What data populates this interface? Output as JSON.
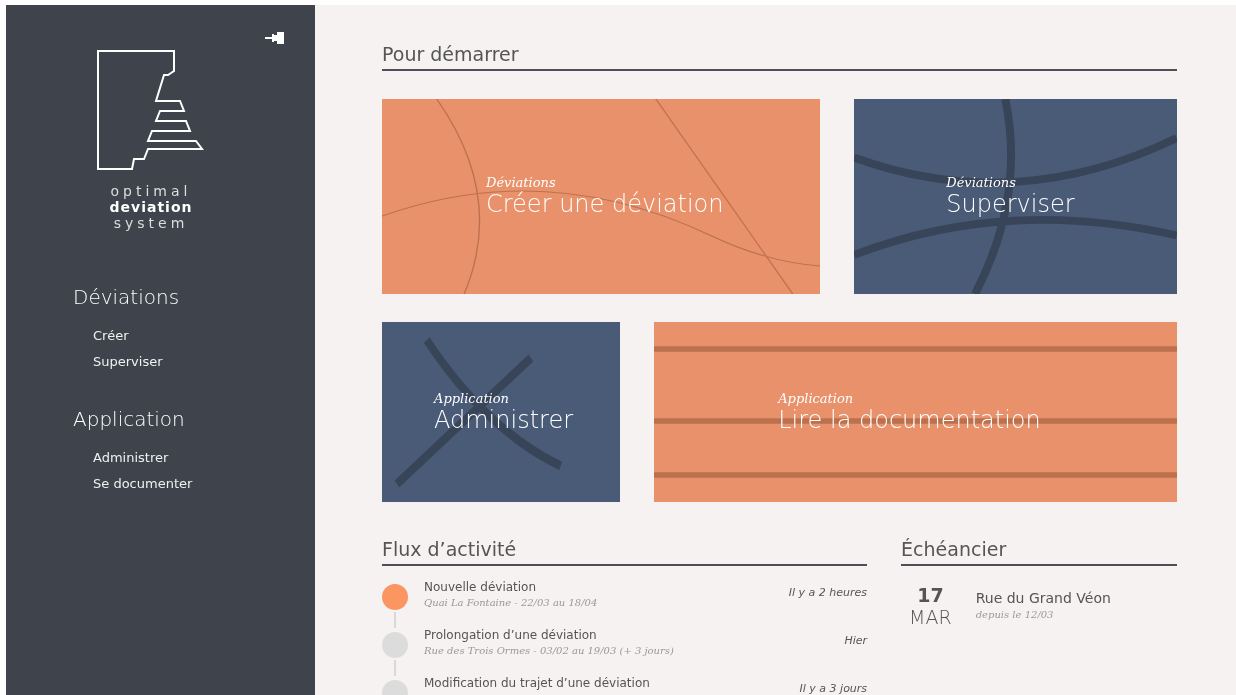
{
  "sidebar": {
    "logo": {
      "line_1": "optimal",
      "line_2": "deviation",
      "line_3": "system"
    },
    "sections": [
      {
        "title": "Déviations",
        "items": [
          "Créer",
          "Superviser"
        ]
      },
      {
        "title": "Application",
        "items": [
          "Administrer",
          "Se documenter"
        ]
      }
    ]
  },
  "start": {
    "title": "Pour démarrer",
    "rows": [
      [
        {
          "category": "Déviations",
          "label": "Créer une déviation",
          "color": "#e8916a",
          "kind": "map"
        },
        {
          "category": "Déviations",
          "label": "Superviser",
          "color": "#4a5b78",
          "kind": "highway"
        }
      ],
      [
        {
          "category": "Application",
          "label": "Administrer",
          "color": "#4a5b78",
          "kind": "tools"
        },
        {
          "category": "Application",
          "label": "Lire la documentation",
          "color": "#e8916a",
          "kind": "books"
        }
      ]
    ]
  },
  "activity": {
    "title": "Flux d’activité",
    "items": [
      {
        "title": "Nouvelle déviation",
        "detail": "Quai La Fontaine - 22/03 au 18/04",
        "time": "Il y a 2 heures",
        "highlighted": true
      },
      {
        "title": "Prolongation d’une déviation",
        "detail": "Rue des Trois Ormes - 03/02 au 19/03  (+ 3 jours)",
        "time": "Hier",
        "highlighted": false
      },
      {
        "title": "Modification du trajet d’une déviation",
        "time": "Il y a 3 jours",
        "highlighted": false
      }
    ]
  },
  "schedule": {
    "title": "Échéancier",
    "items": [
      {
        "day": "17",
        "month": "MAR",
        "place": "Rue du Grand Véon",
        "since": "depuis le 12/03"
      }
    ]
  }
}
